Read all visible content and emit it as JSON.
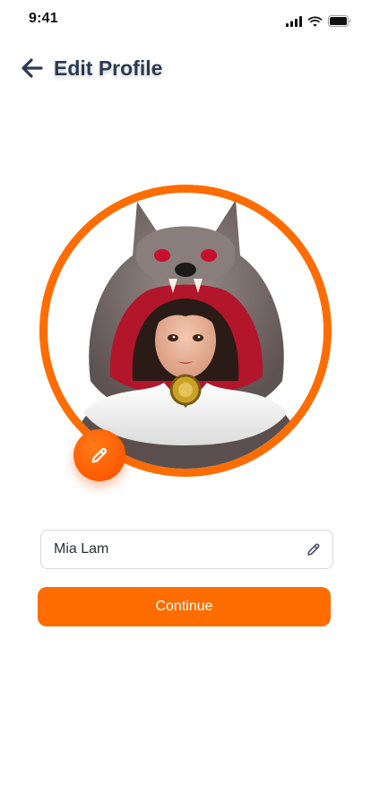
{
  "status_bar": {
    "time": "9:41",
    "icons": [
      "cellular-signal-icon",
      "wifi-icon",
      "battery-icon"
    ]
  },
  "header": {
    "title": "Edit Profile",
    "back_icon": "arrow-left-icon"
  },
  "avatar": {
    "description_icon": "wolf-hood-character-avatar",
    "edit_icon": "pencil-icon"
  },
  "name_field": {
    "value": "Mia Lam",
    "edit_icon": "pencil-icon"
  },
  "continue_button": {
    "label": "Continue"
  },
  "colors": {
    "accent": "#ff6c00",
    "title": "#2b3a52",
    "border": "#d5d9de"
  }
}
